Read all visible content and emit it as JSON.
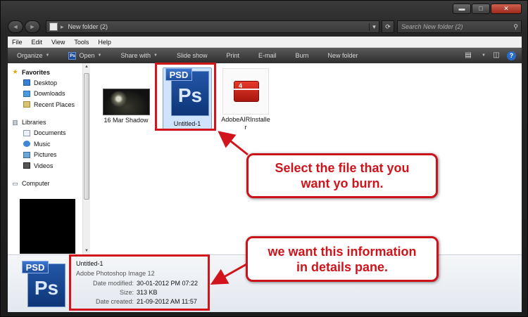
{
  "window": {
    "minimize_label": "▬",
    "maximize_label": "□",
    "close_label": "✕"
  },
  "address": {
    "back_label": "◄",
    "forward_label": "►",
    "separator": "▸",
    "path": "New folder (2)",
    "dropdown": "▾",
    "refresh": "⟳",
    "search_placeholder": "Search New folder (2)",
    "search_glyph": "⚲"
  },
  "menu": {
    "file": "File",
    "edit": "Edit",
    "view": "View",
    "tools": "Tools",
    "help": "Help"
  },
  "toolbar": {
    "organize": "Organize",
    "open": "Open",
    "share_with": "Share with",
    "slide_show": "Slide show",
    "print": "Print",
    "email": "E-mail",
    "burn": "Burn",
    "new_folder": "New folder",
    "caret": "▼",
    "ps_badge": "Ps",
    "views_glyph": "▤",
    "preview_glyph": "◫",
    "help_glyph": "?"
  },
  "sidebar": {
    "favorites": {
      "label": "Favorites",
      "items": [
        "Desktop",
        "Downloads",
        "Recent Places"
      ]
    },
    "libraries": {
      "label": "Libraries",
      "items": [
        "Documents",
        "Music",
        "Pictures",
        "Videos"
      ]
    },
    "computer": {
      "label": "Computer"
    },
    "icons": {
      "star": "★",
      "libraries": "▥",
      "computer": "▭",
      "scroll_up": "▲",
      "scroll_down": "▼"
    }
  },
  "files": [
    {
      "name": "16 Mar Shadow",
      "type": "image"
    },
    {
      "name": "Untitled-1",
      "type": "psd",
      "selected": true,
      "badge": "PSD",
      "logo": "Ps"
    },
    {
      "name_line1": "AdobeAIRInstalle",
      "name_line2": "r",
      "type": "installer",
      "badge_num": "4"
    }
  ],
  "details": {
    "badge": "PSD",
    "logo": "Ps",
    "title": "Untitled-1",
    "type": "Adobe Photoshop Image 12",
    "rows": [
      {
        "label": "Date modified:",
        "value": "30-01-2012 PM 07:22"
      },
      {
        "label": "Size:",
        "value": "313 KB"
      },
      {
        "label": "Date created:",
        "value": "21-09-2012 AM 11:57"
      }
    ]
  },
  "annotations": {
    "callout1_line1": "Select the file that you",
    "callout1_line2": "want yo burn.",
    "callout2_line1": "we want this information",
    "callout2_line2": "in details pane.",
    "accent_color": "#d2151c"
  }
}
